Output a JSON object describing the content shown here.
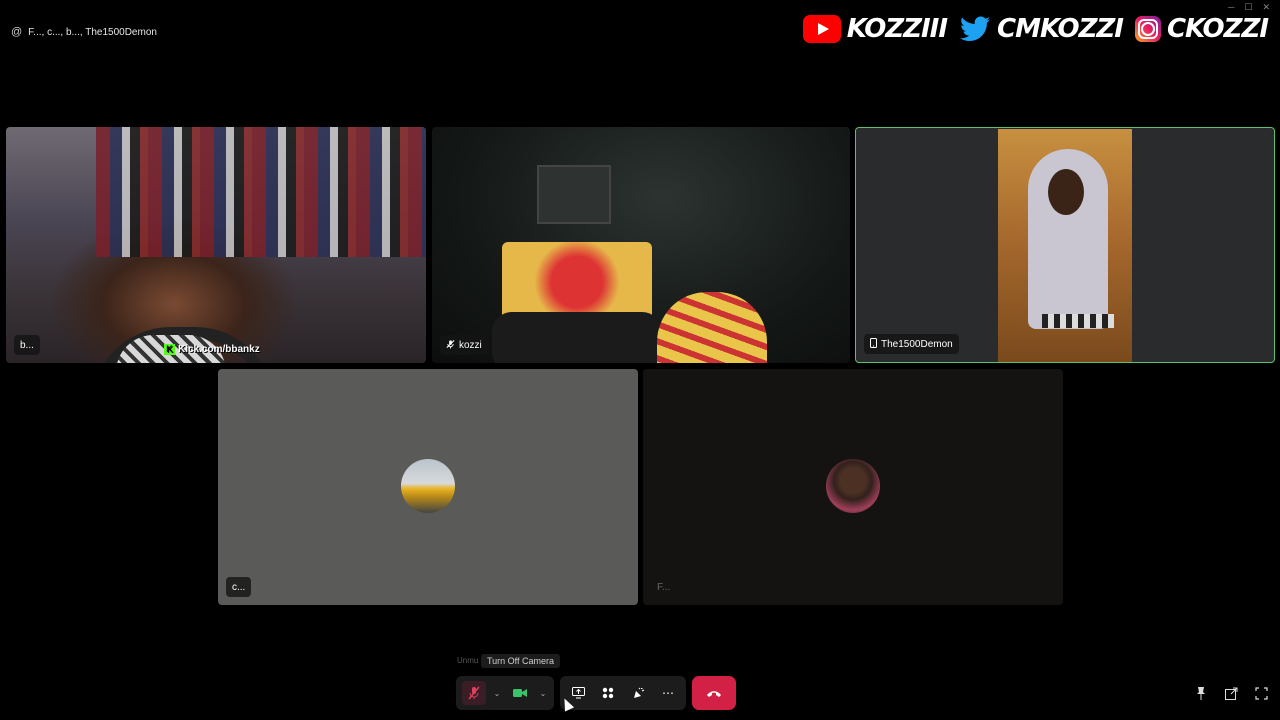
{
  "header": {
    "participants_label": "F..., c..., b..., The1500Demon"
  },
  "overlay": {
    "youtube_handle": "KOZZIII",
    "twitter_handle": "CMKOZZI",
    "instagram_handle": "CKOZZI"
  },
  "tiles": [
    {
      "name": "b...",
      "overlay_text": "Kick.com/bbankz"
    },
    {
      "name": "kozzi"
    },
    {
      "name": "The1500Demon"
    },
    {
      "name": "c..."
    },
    {
      "name": "F..."
    }
  ],
  "controls": {
    "tooltip": "Turn Off Camera",
    "tooltip_ghost": "Unmu"
  },
  "colors": {
    "active_speaker_border": "#58c36a",
    "hangup": "#d32045",
    "camera_on": "#3ac46a"
  }
}
